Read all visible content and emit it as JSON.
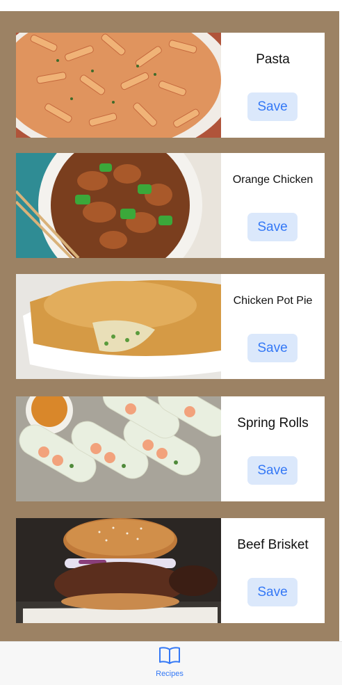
{
  "recipes": [
    {
      "title": "Pasta",
      "save_label": "Save",
      "image": "pasta-photo"
    },
    {
      "title": "Orange Chicken",
      "save_label": "Save",
      "image": "orange-chicken-photo"
    },
    {
      "title": "Chicken Pot Pie",
      "save_label": "Save",
      "image": "chicken-pot-pie-photo"
    },
    {
      "title": "Spring Rolls",
      "save_label": "Save",
      "image": "spring-rolls-photo"
    },
    {
      "title": "Beef Brisket",
      "save_label": "Save",
      "image": "beef-brisket-photo"
    }
  ],
  "tabbar": {
    "tabs": [
      {
        "label": "Recipes",
        "icon": "book-icon",
        "selected": true
      }
    ]
  },
  "colors": {
    "background": "#9c8264",
    "accent": "#3478f6",
    "button_fill": "#dbe8fb",
    "card": "#ffffff"
  }
}
